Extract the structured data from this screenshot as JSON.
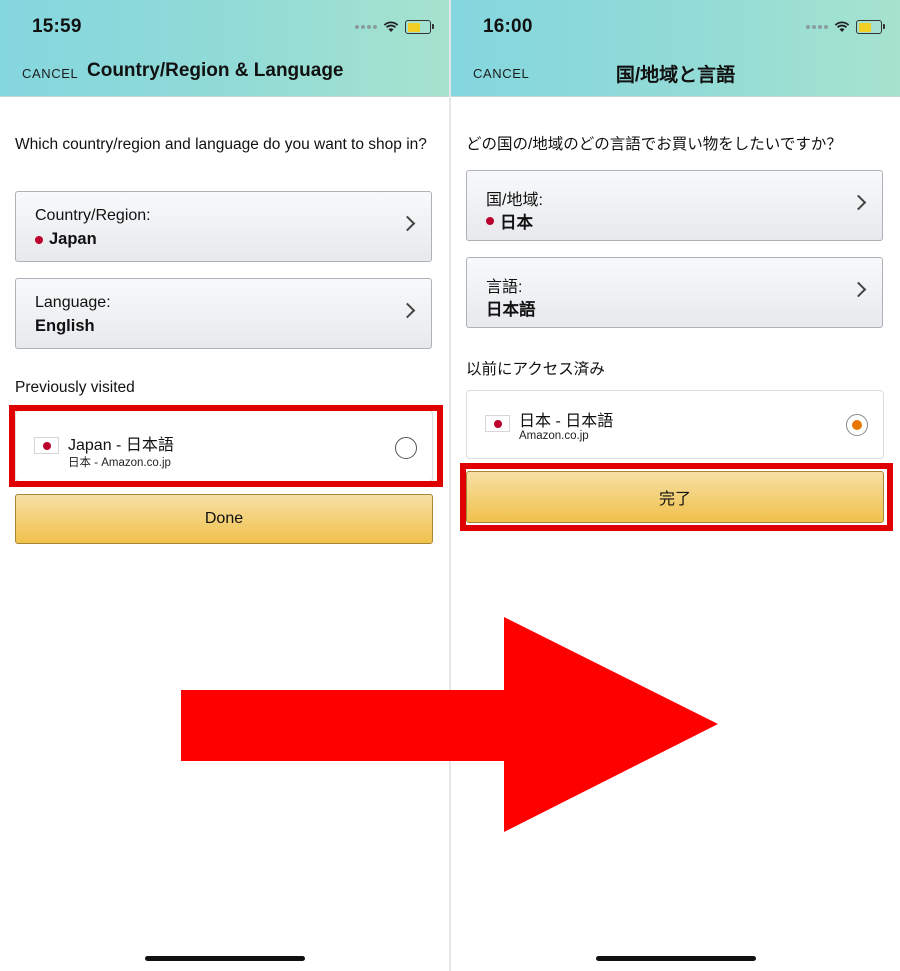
{
  "left": {
    "status": {
      "time": "15:59",
      "battery_level": 0.55
    },
    "header": {
      "cancel": "CANCEL",
      "title": "Country/Region & Language"
    },
    "question": "Which country/region and language do you want to shop in?",
    "country": {
      "label": "Country/Region:",
      "value": "Japan"
    },
    "language": {
      "label": "Language:",
      "value": "English"
    },
    "previous_label": "Previously visited",
    "visited": {
      "main": "Japan - 日本語",
      "sub": "日本 - Amazon.co.jp",
      "selected": false
    },
    "done": "Done"
  },
  "right": {
    "status": {
      "time": "16:00",
      "battery_level": 0.55
    },
    "header": {
      "cancel": "CANCEL",
      "title": "国/地域と言語"
    },
    "question": "どの国の/地域のどの言語でお買い物をしたいですか？",
    "country": {
      "label": "国/地域:",
      "value": "日本"
    },
    "language": {
      "label": "言語:",
      "value": "日本語"
    },
    "previous_label": "以前にアクセス済み",
    "visited": {
      "main": "日本 - 日本語",
      "sub": "Amazon.co.jp",
      "selected": true
    },
    "done": "完了"
  },
  "colors": {
    "header_gradient": [
      "#84d6df",
      "#a6e3ce"
    ],
    "button_yellow": "#f0c14b",
    "highlight_red": "#e00000",
    "arrow_red": "#ff0000",
    "radio_selected": "#e77600",
    "flag_red": "#bc002d"
  },
  "icons": [
    "wifi-icon",
    "battery-icon",
    "signal-icon",
    "chevron-right-icon",
    "japan-flag-icon",
    "radio-button",
    "right-arrow-icon"
  ]
}
